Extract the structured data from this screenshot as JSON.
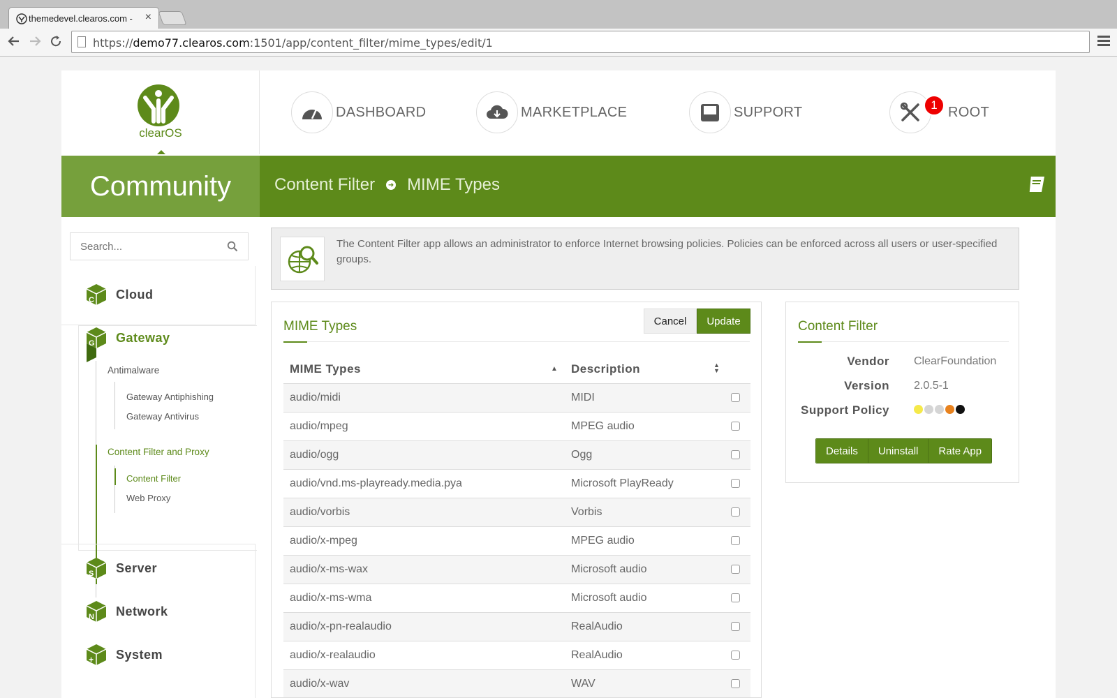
{
  "browser": {
    "tab_title": "themedevel.clearos.com -",
    "tab_close": "×",
    "url_prefix": "https://",
    "url_host": "demo77.clearos.com",
    "url_path": ":1501/app/content_filter/mime_types/edit/1"
  },
  "header": {
    "logo_text": "clearOS",
    "nav": [
      {
        "label": "DASHBOARD",
        "icon": "gauge-icon"
      },
      {
        "label": "MARKETPLACE",
        "icon": "cloud-download-icon"
      },
      {
        "label": "SUPPORT",
        "icon": "inbox-icon"
      },
      {
        "label": "ROOT",
        "icon": "tools-icon",
        "badge": "1"
      }
    ],
    "edition": "Community",
    "breadcrumb": [
      "Content Filter",
      "MIME Types"
    ],
    "colors": {
      "green": "#5d8a1a",
      "light_green": "#76a03c",
      "badge": "#ee0000"
    }
  },
  "sidebar": {
    "search_placeholder": "Search...",
    "categories": [
      {
        "label": "Cloud",
        "letter": "C"
      },
      {
        "label": "Gateway",
        "letter": "G"
      },
      {
        "label": "Server",
        "letter": "S"
      },
      {
        "label": "Network",
        "letter": "N"
      },
      {
        "label": "System",
        "letter": "+"
      }
    ],
    "gateway_groups": [
      {
        "label": "Antimalware",
        "items": [
          "Gateway Antiphishing",
          "Gateway Antivirus"
        ]
      },
      {
        "label": "Content Filter and Proxy",
        "items": [
          "Content Filter",
          "Web Proxy"
        ]
      }
    ]
  },
  "intro": {
    "text": "The Content Filter app allows an administrator to enforce Internet browsing policies. Policies can be enforced across all users or user-specified groups."
  },
  "mime_panel": {
    "title": "MIME Types",
    "cancel_label": "Cancel",
    "update_label": "Update",
    "columns": [
      "MIME Types",
      "Description"
    ],
    "rows": [
      [
        "audio/midi",
        "MIDI"
      ],
      [
        "audio/mpeg",
        "MPEG audio"
      ],
      [
        "audio/ogg",
        "Ogg"
      ],
      [
        "audio/vnd.ms-playready.media.pya",
        "Microsoft PlayReady"
      ],
      [
        "audio/vorbis",
        "Vorbis"
      ],
      [
        "audio/x-mpeg",
        "MPEG audio"
      ],
      [
        "audio/x-ms-wax",
        "Microsoft audio"
      ],
      [
        "audio/x-ms-wma",
        "Microsoft audio"
      ],
      [
        "audio/x-pn-realaudio",
        "RealAudio"
      ],
      [
        "audio/x-realaudio",
        "RealAudio"
      ],
      [
        "audio/x-wav",
        "WAV"
      ]
    ]
  },
  "app_panel": {
    "title": "Content Filter",
    "vendor_label": "Vendor",
    "vendor": "ClearFoundation",
    "version_label": "Version",
    "version": "2.0.5-1",
    "support_label": "Support Policy",
    "support_dots": [
      "#f5e94a",
      "#d5d5d5",
      "#d5d5d5",
      "#e8821e",
      "#111111"
    ],
    "buttons": [
      "Details",
      "Uninstall",
      "Rate App"
    ]
  }
}
